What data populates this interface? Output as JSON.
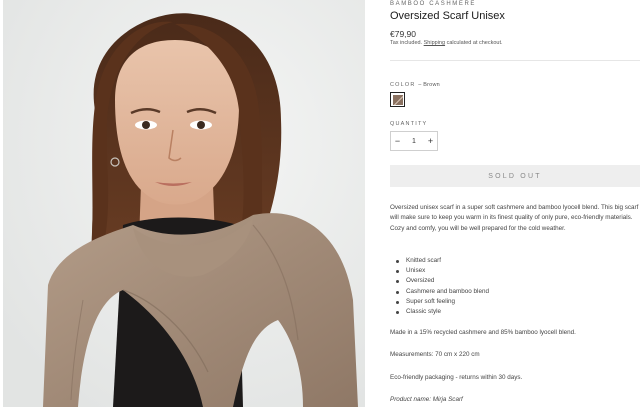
{
  "product": {
    "vendor": "BAMBOO CASHMERE",
    "title": "Oversized Scarf Unisex",
    "price": "€79,90",
    "tax_prefix": "Tax included.",
    "tax_link": "Shipping",
    "tax_suffix": "calculated at checkout.",
    "image_alt": "Woman wearing brown oversized cashmere scarf"
  },
  "options": {
    "color_label": "COLOR",
    "color_value": "– Brown",
    "swatch_color": "#8a7160",
    "quantity_label": "QUANTITY",
    "quantity_value": "1",
    "minus": "−",
    "plus": "+"
  },
  "cta": {
    "sold_out_label": "SOLD OUT"
  },
  "description": {
    "intro": "Oversized unisex scarf in a super soft cashmere and bamboo lyocell blend. This big scarf will make sure to keep you warm in its finest quality of only pure, eco-friendly materials. Cozy and comfy, you will be well prepared for the cold weather.",
    "features": [
      "Knitted scarf",
      "Unisex",
      "Oversized",
      "Cashmere and bamboo blend",
      "Super soft feeling",
      "Classic style"
    ],
    "material": "Made in a 15% recycled cashmere and 85% bamboo lyocell blend.",
    "measurements": "Measurements: 70 cm x 220 cm",
    "packaging": "Eco-friendly packaging - returns within 30 days.",
    "product_name": "Product name: Mirja Scarf"
  }
}
